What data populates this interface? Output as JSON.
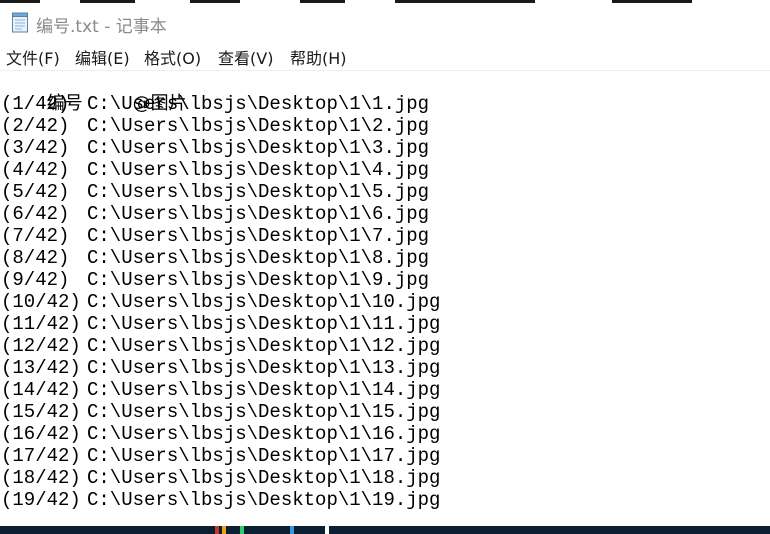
{
  "window": {
    "title": "编号.txt - 记事本",
    "icon": "notepad-icon"
  },
  "menu": [
    {
      "label": "文件(F)"
    },
    {
      "label": "编辑(E)"
    },
    {
      "label": "格式(O)"
    },
    {
      "label": "查看(V)"
    },
    {
      "label": "帮助(H)"
    }
  ],
  "document": {
    "header": {
      "col1": "编号",
      "col2": "@图片"
    },
    "rows": [
      {
        "number": "(1/42)",
        "path": "C:\\Users\\lbsjs\\Desktop\\1\\1.jpg"
      },
      {
        "number": "(2/42)",
        "path": "C:\\Users\\lbsjs\\Desktop\\1\\2.jpg"
      },
      {
        "number": "(3/42)",
        "path": "C:\\Users\\lbsjs\\Desktop\\1\\3.jpg"
      },
      {
        "number": "(4/42)",
        "path": "C:\\Users\\lbsjs\\Desktop\\1\\4.jpg"
      },
      {
        "number": "(5/42)",
        "path": "C:\\Users\\lbsjs\\Desktop\\1\\5.jpg"
      },
      {
        "number": "(6/42)",
        "path": "C:\\Users\\lbsjs\\Desktop\\1\\6.jpg"
      },
      {
        "number": "(7/42)",
        "path": "C:\\Users\\lbsjs\\Desktop\\1\\7.jpg"
      },
      {
        "number": "(8/42)",
        "path": "C:\\Users\\lbsjs\\Desktop\\1\\8.jpg"
      },
      {
        "number": "(9/42)",
        "path": "C:\\Users\\lbsjs\\Desktop\\1\\9.jpg"
      },
      {
        "number": "(10/42)",
        "path": "C:\\Users\\lbsjs\\Desktop\\1\\10.jpg"
      },
      {
        "number": "(11/42)",
        "path": "C:\\Users\\lbsjs\\Desktop\\1\\11.jpg"
      },
      {
        "number": "(12/42)",
        "path": "C:\\Users\\lbsjs\\Desktop\\1\\12.jpg"
      },
      {
        "number": "(13/42)",
        "path": "C:\\Users\\lbsjs\\Desktop\\1\\13.jpg"
      },
      {
        "number": "(14/42)",
        "path": "C:\\Users\\lbsjs\\Desktop\\1\\14.jpg"
      },
      {
        "number": "(15/42)",
        "path": "C:\\Users\\lbsjs\\Desktop\\1\\15.jpg"
      },
      {
        "number": "(16/42)",
        "path": "C:\\Users\\lbsjs\\Desktop\\1\\16.jpg"
      },
      {
        "number": "(17/42)",
        "path": "C:\\Users\\lbsjs\\Desktop\\1\\17.jpg"
      },
      {
        "number": "(18/42)",
        "path": "C:\\Users\\lbsjs\\Desktop\\1\\18.jpg"
      },
      {
        "number": "(19/42)",
        "path": "C:\\Users\\lbsjs\\Desktop\\1\\19.jpg"
      }
    ]
  },
  "colors": {
    "background": "#ffffff",
    "text": "#000000",
    "title_text": "#8a8a8a",
    "taskbar": "#0b1f33"
  }
}
